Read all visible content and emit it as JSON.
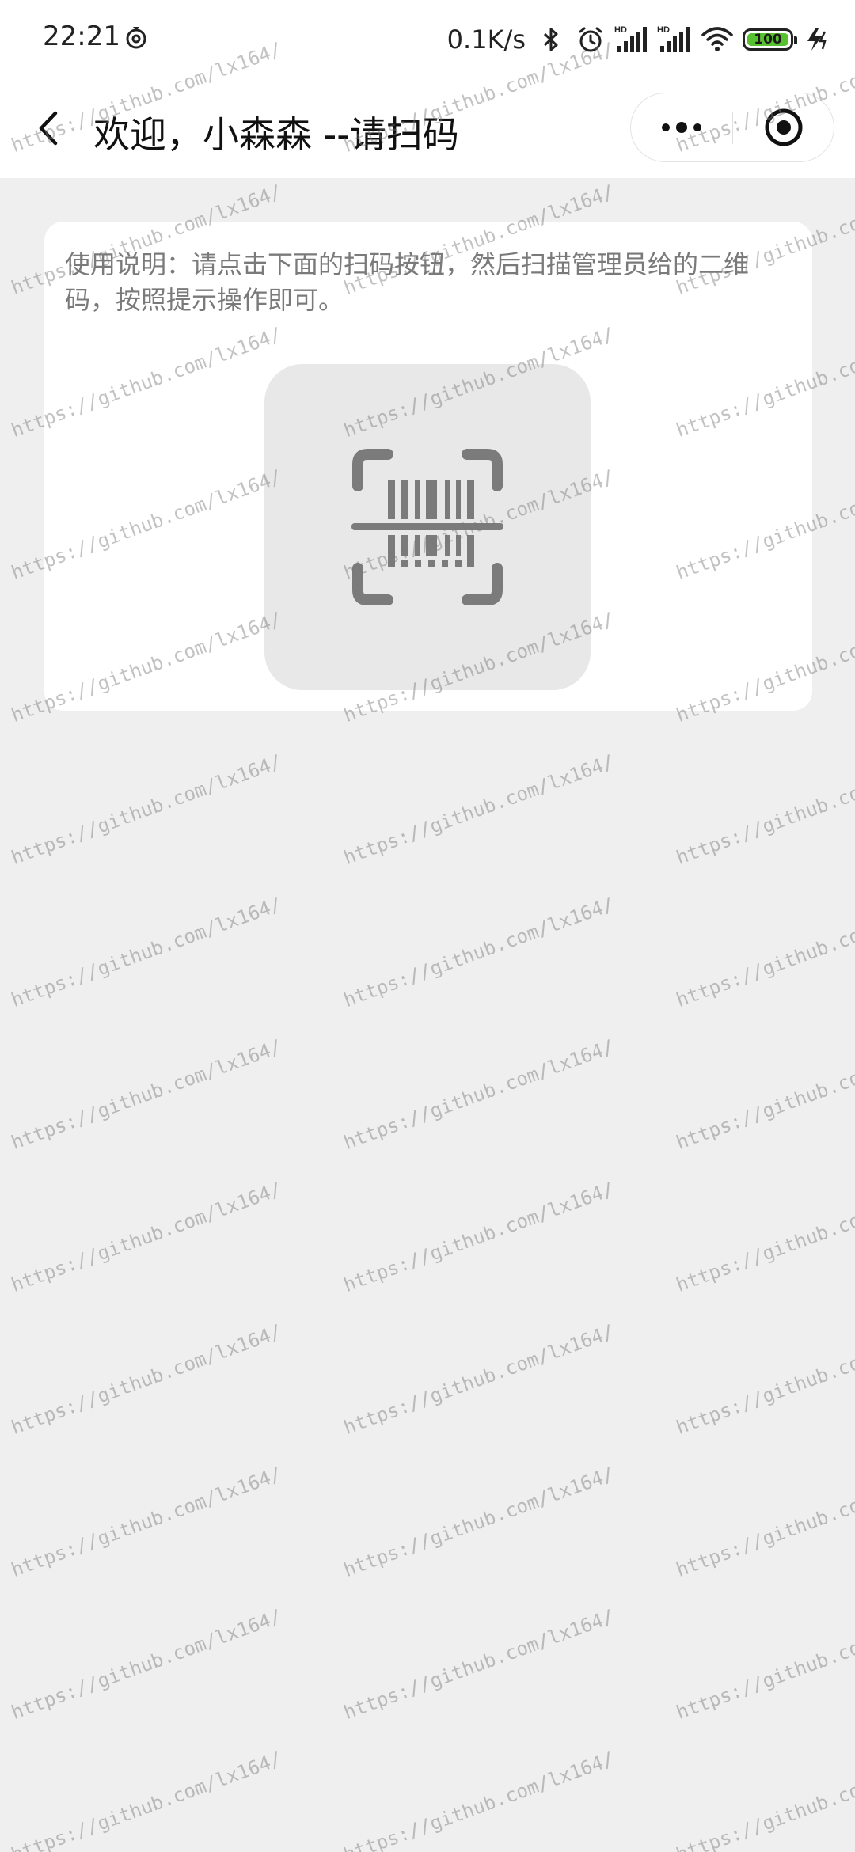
{
  "status_bar": {
    "time": "22:21",
    "network_speed": "0.1K/s",
    "battery_level": "100",
    "icons": [
      "sync-icon",
      "bluetooth-icon",
      "alarm-icon",
      "hd-signal-icon",
      "hd-signal-icon",
      "wifi-icon",
      "battery-icon",
      "charging-icon"
    ]
  },
  "nav": {
    "title": "欢迎，小森森 --请扫码",
    "back_icon": "chevron-left-icon",
    "more_icon": "more-dots-icon",
    "close_icon": "target-close-icon"
  },
  "card": {
    "instructions": "使用说明：请点击下面的扫码按钮，然后扫描管理员给的二维码，按照提示操作即可。",
    "scan_icon": "barcode-scan-icon"
  },
  "watermark": {
    "text": "https://github.com/lx164/"
  },
  "colors": {
    "background": "#efefef",
    "card": "#ffffff",
    "scan_button": "#e8e8e8",
    "icon_gray": "#7b7b7b",
    "battery_green": "#58c12f"
  }
}
